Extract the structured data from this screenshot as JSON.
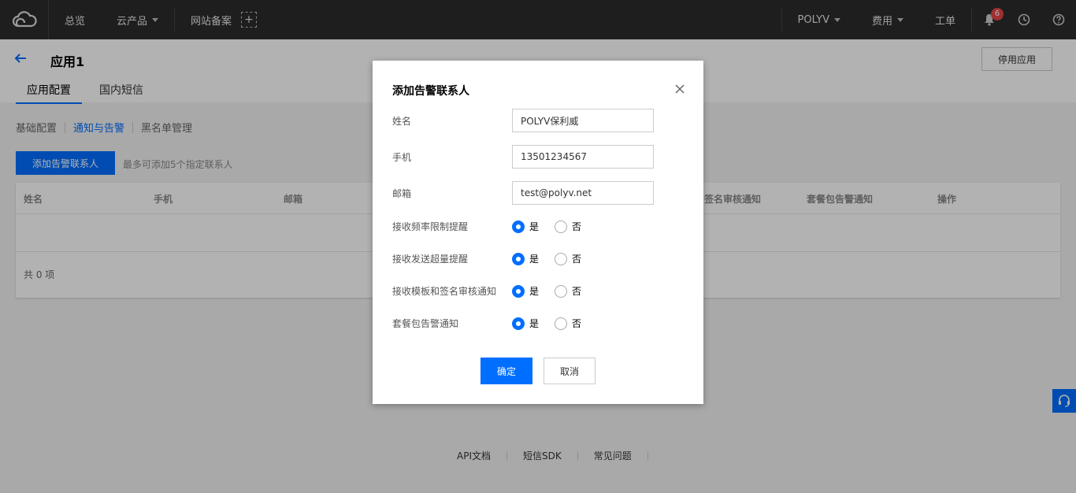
{
  "topbar": {
    "nav": {
      "overview": "总览",
      "products": "云产品",
      "beian": "网站备案",
      "plus": "+"
    },
    "account": "POLYV",
    "fees": "费用",
    "tickets": "工单",
    "notifications_count": "6"
  },
  "page": {
    "title": "应用1",
    "stop_app": "停用应用",
    "tabs": [
      {
        "label": "应用配置"
      },
      {
        "label": "国内短信"
      }
    ],
    "subtabs": [
      {
        "label": "基础配置"
      },
      {
        "label": "通知与告警"
      },
      {
        "label": "黑名单管理"
      }
    ],
    "add_button": "添加告警联系人",
    "add_tip": "最多可添加5个指定联系人",
    "table": {
      "columns": [
        "姓名",
        "手机",
        "邮箱",
        "签名审核通知",
        "套餐包告警通知",
        "操作"
      ],
      "total": "共 0 项"
    }
  },
  "footer": {
    "links": [
      "API文档",
      "短信SDK",
      "常见问题"
    ]
  },
  "modal": {
    "title": "添加告警联系人",
    "fields": {
      "name_label": "姓名",
      "name_value": "POLYV保利威",
      "phone_label": "手机",
      "phone_value": "13501234567",
      "email_label": "邮箱",
      "email_value": "test@polyv.net"
    },
    "radios": [
      {
        "label": "接收频率限制提醒",
        "yes": "是",
        "no": "否",
        "selected": "是"
      },
      {
        "label": "接收发送超量提醒",
        "yes": "是",
        "no": "否",
        "selected": "是"
      },
      {
        "label": "接收模板和签名审核通知",
        "yes": "是",
        "no": "否",
        "selected": "是"
      },
      {
        "label": "套餐包告警通知",
        "yes": "是",
        "no": "否",
        "selected": "是"
      }
    ],
    "ok": "确定",
    "cancel": "取消"
  },
  "colors": {
    "accent": "#006eff",
    "topbar_bg": "#2b2b2b",
    "badge": "#e54545"
  }
}
